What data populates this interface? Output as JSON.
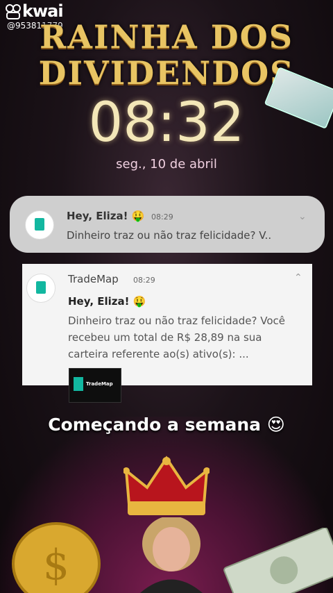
{
  "watermark": {
    "brand": "kwai",
    "handle": "@953811779"
  },
  "title": {
    "line1": "RAINHA DOS",
    "line2": "DIVIDENDOS"
  },
  "lockscreen": {
    "time": "08:32",
    "date": "seg., 10 de abril"
  },
  "notification_collapsed": {
    "title": "Hey, Eliza! 🤑",
    "time": "08:29",
    "text": "Dinheiro traz ou não traz felicidade? V.."
  },
  "notification_expanded": {
    "app": "TradeMap",
    "time": "08:29",
    "title": "Hey, Eliza! 🤑",
    "body": "Dinheiro traz ou não traz felicidade? Você recebeu um total de R$ 28,89 na sua carteira referente ao(s) ativo(s): ...",
    "thumb_label": "TradeMap"
  },
  "caption": "Começando a semana 😍",
  "colors": {
    "gold": "#e8c463",
    "app_accent": "#12b7a0"
  }
}
